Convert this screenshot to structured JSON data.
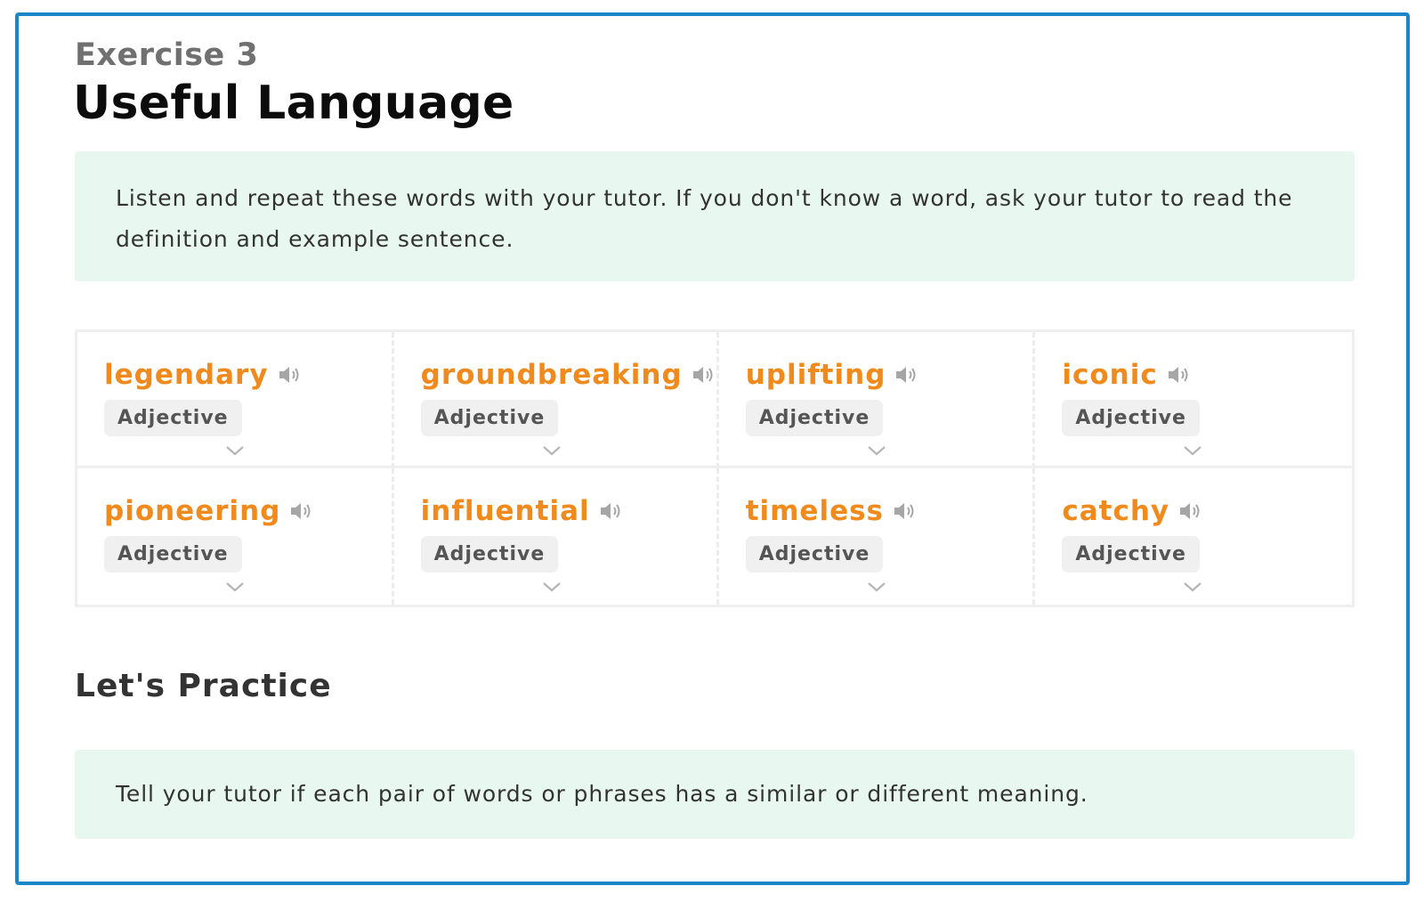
{
  "exercise": {
    "subtitle": "Exercise 3",
    "title": "Useful Language",
    "instructions": "Listen and repeat these words with your tutor. If you don't know a word, ask your tutor to read the definition and example sentence."
  },
  "vocabulary": [
    {
      "word": "legendary",
      "part_of_speech": "Adjective"
    },
    {
      "word": "groundbreaking",
      "part_of_speech": "Adjective"
    },
    {
      "word": "uplifting",
      "part_of_speech": "Adjective"
    },
    {
      "word": "iconic",
      "part_of_speech": "Adjective"
    },
    {
      "word": "pioneering",
      "part_of_speech": "Adjective"
    },
    {
      "word": "influential",
      "part_of_speech": "Adjective"
    },
    {
      "word": "timeless",
      "part_of_speech": "Adjective"
    },
    {
      "word": "catchy",
      "part_of_speech": "Adjective"
    }
  ],
  "practice": {
    "title": "Let's Practice",
    "instructions": "Tell your tutor if each pair of words or phrases has a similar or different meaning."
  },
  "colors": {
    "frame_border": "#1a86c7",
    "word_accent": "#f08a1c",
    "instruction_bg": "#e8f8f1"
  }
}
